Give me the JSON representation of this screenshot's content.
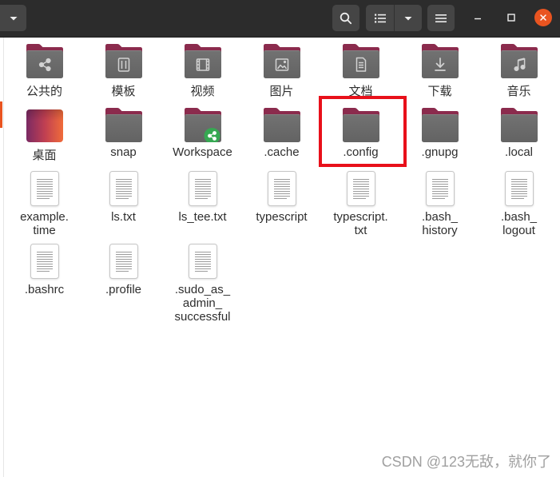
{
  "window": {
    "header": {
      "path_dropdown_icon": "chevron-down-icon",
      "search_icon": "search-icon",
      "view_icon": "list-view-icon",
      "view_options_icon": "chevron-down-icon",
      "menu_icon": "hamburger-menu-icon",
      "minimize_icon": "minimize-icon",
      "maximize_icon": "maximize-icon",
      "close_icon": "close-icon"
    }
  },
  "colors": {
    "header_bg": "#2c2c2c",
    "header_button": "#454545",
    "close_button": "#e95420",
    "folder_tab": "#8b2b4d",
    "folder_body": "#727272",
    "label_text": "#2e2e2e",
    "annotation_box": "#e8101a",
    "sidebar_selection": "#e95420",
    "share_badge": "#36a852",
    "watermark": "#a0a0a0"
  },
  "grid": {
    "rows": [
      [
        {
          "label": "公共的",
          "icon": "folder-icon",
          "emblem": "share-icon"
        },
        {
          "label": "模板",
          "icon": "folder-icon",
          "emblem": "template-icon"
        },
        {
          "label": "视频",
          "icon": "folder-icon",
          "emblem": "video-icon"
        },
        {
          "label": "图片",
          "icon": "folder-icon",
          "emblem": "picture-icon"
        },
        {
          "label": "文档",
          "icon": "folder-icon",
          "emblem": "document-icon"
        },
        {
          "label": "下载",
          "icon": "folder-icon",
          "emblem": "download-icon"
        },
        {
          "label": "音乐",
          "icon": "folder-icon",
          "emblem": "music-icon"
        }
      ],
      [
        {
          "label": "桌面",
          "icon": "desktop-folder-icon"
        },
        {
          "label": "snap",
          "icon": "folder-icon"
        },
        {
          "label": "Workspace",
          "icon": "folder-icon",
          "emblem": "shared-badge-icon"
        },
        {
          "label": ".cache",
          "icon": "folder-icon"
        },
        {
          "label": ".config",
          "icon": "folder-icon",
          "highlighted": true
        },
        {
          "label": ".gnupg",
          "icon": "folder-icon"
        },
        {
          "label": ".local",
          "icon": "folder-icon"
        }
      ],
      [
        {
          "label": "example.\ntime",
          "icon": "text-file-icon"
        },
        {
          "label": "ls.txt",
          "icon": "text-file-icon"
        },
        {
          "label": "ls_tee.txt",
          "icon": "text-file-icon"
        },
        {
          "label": "typescript",
          "icon": "text-file-icon"
        },
        {
          "label": "typescript.\ntxt",
          "icon": "text-file-icon"
        },
        {
          "label": ".bash_\nhistory",
          "icon": "text-file-icon"
        },
        {
          "label": ".bash_\nlogout",
          "icon": "text-file-icon"
        }
      ],
      [
        {
          "label": ".bashrc",
          "icon": "text-file-icon"
        },
        {
          "label": ".profile",
          "icon": "text-file-icon"
        },
        {
          "label": ".sudo_as_\nadmin_\nsuccessful",
          "icon": "text-file-icon"
        }
      ]
    ]
  },
  "watermark": "CSDN @123无敌，就你了"
}
